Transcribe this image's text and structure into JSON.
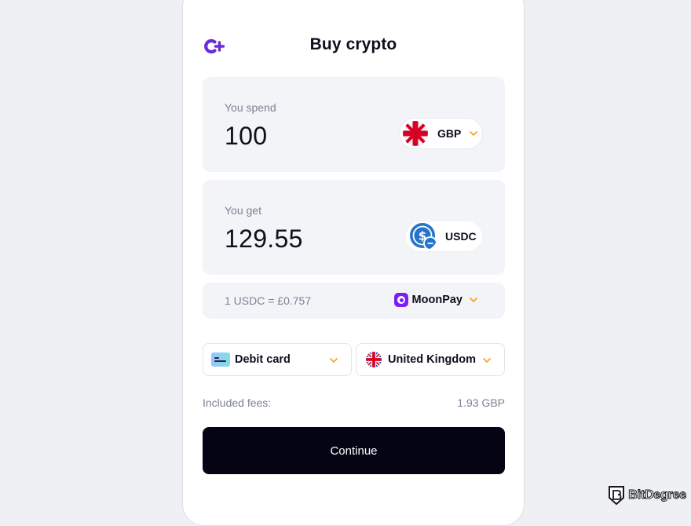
{
  "header": {
    "title": "Buy crypto",
    "logo_icon": "c-plus-logo-icon",
    "brand_color": "#6b2bd9"
  },
  "spend": {
    "label": "You spend",
    "amount": "100",
    "currency": "GBP",
    "currency_icon": "uk-flag-icon"
  },
  "receive": {
    "label": "You get",
    "amount": "129.55",
    "currency": "USDC",
    "currency_icon": "usdc-coin-icon"
  },
  "rate": {
    "text": "1 USDC = £0.757",
    "provider": "MoonPay",
    "provider_icon": "moonpay-icon",
    "provider_color": "#7d1df0"
  },
  "payment": {
    "method": "Debit card",
    "method_icon": "debit-card-icon",
    "country": "United Kingdom",
    "country_icon": "uk-flag-icon"
  },
  "fees": {
    "label": "Included fees:",
    "value": "1.93 GBP"
  },
  "continue_label": "Continue",
  "accent_color": "#f5a623",
  "watermark": {
    "text": "BitDegree",
    "icon": "bitdegree-shield-icon"
  }
}
